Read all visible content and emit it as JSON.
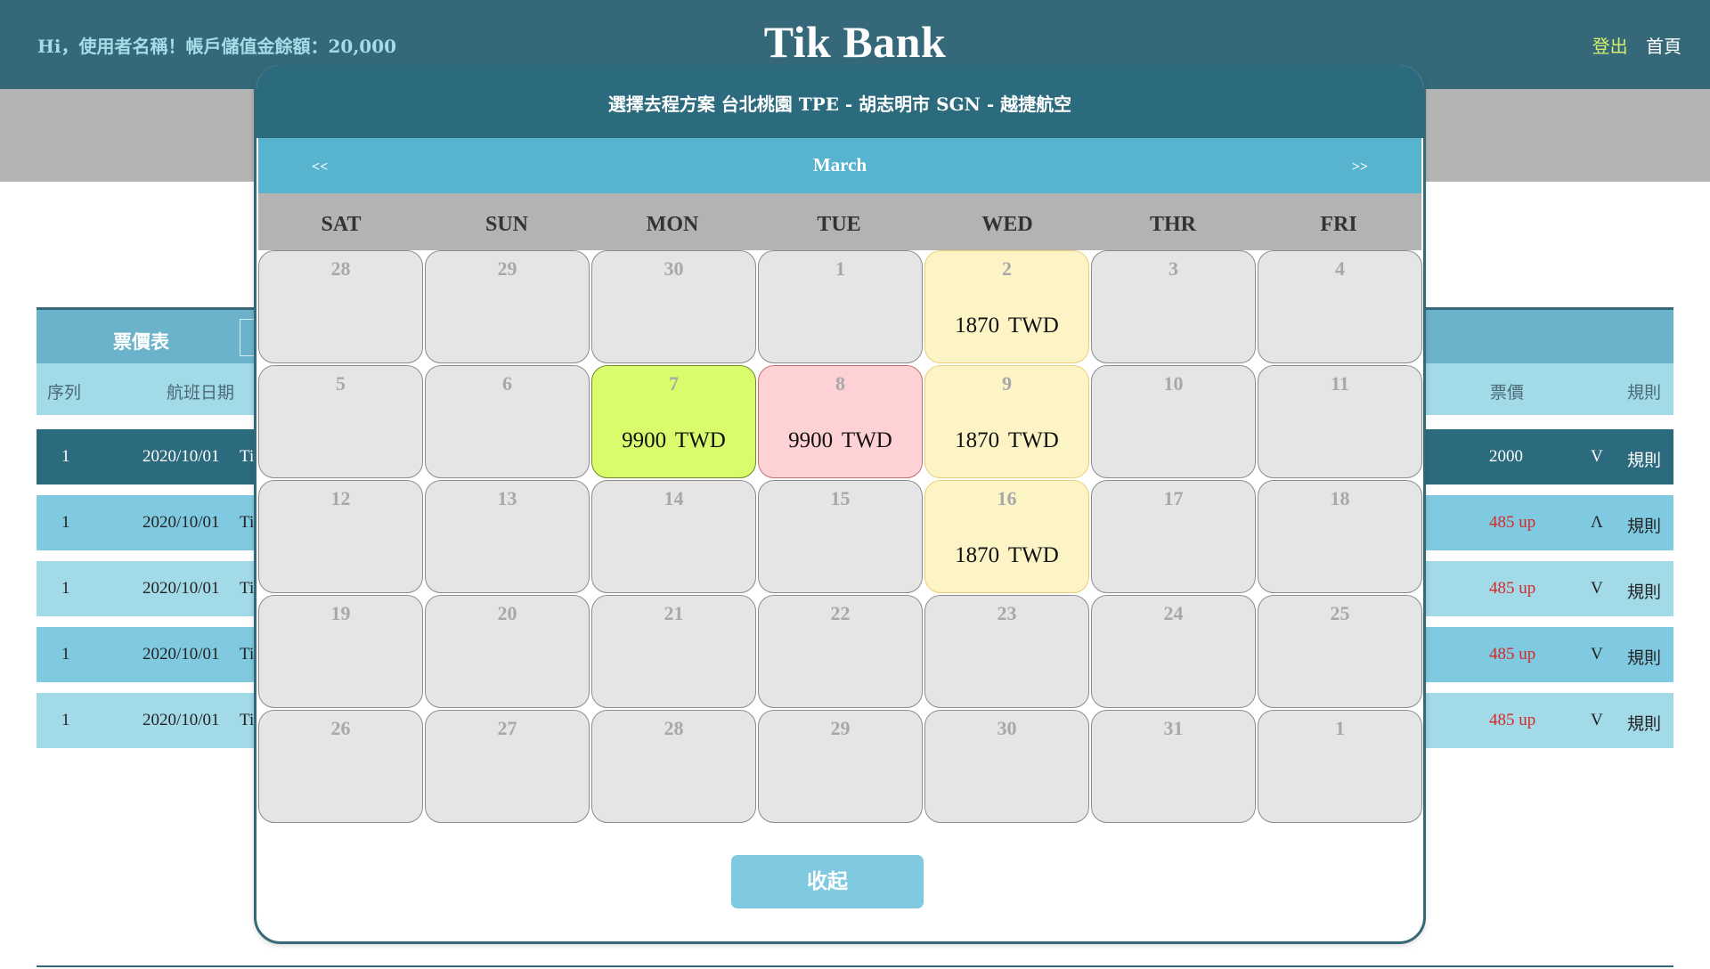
{
  "header": {
    "greeting": "Hi，使用者名稱！帳戶儲值金餘額：20,000",
    "brand": "Tik Bank",
    "logout": "登出",
    "home": "首頁"
  },
  "fare_table": {
    "title": "票價表",
    "columns": {
      "seq": "序列",
      "date": "航班日期",
      "price": "票價",
      "rules": "規則"
    },
    "rows": [
      {
        "seq": "1",
        "date": "2020/10/01",
        "date_suffix": "Ti",
        "price": "2000",
        "toggle": "V",
        "rules": "規則"
      },
      {
        "seq": "1",
        "date": "2020/10/01",
        "date_suffix": "Ti",
        "price": "485 up",
        "toggle": "Λ",
        "rules": "規則"
      },
      {
        "seq": "1",
        "date": "2020/10/01",
        "date_suffix": "Ti",
        "price": "485 up",
        "toggle": "V",
        "rules": "規則"
      },
      {
        "seq": "1",
        "date": "2020/10/01",
        "date_suffix": "Ti",
        "price": "485 up",
        "toggle": "V",
        "rules": "規則"
      },
      {
        "seq": "1",
        "date": "2020/10/01",
        "date_suffix": "Ti",
        "price": "485 up",
        "toggle": "V",
        "rules": "規則"
      }
    ]
  },
  "modal": {
    "title": "選擇去程方案 台北桃園 TPE - 胡志明市 SGN - 越捷航空",
    "month": "March",
    "prev": "<<",
    "next": ">>",
    "weekdays": [
      "SAT",
      "SUN",
      "MON",
      "TUE",
      "WED",
      "THR",
      "FRI"
    ],
    "weeks": [
      [
        {
          "day": "28"
        },
        {
          "day": "29"
        },
        {
          "day": "30"
        },
        {
          "day": "1"
        },
        {
          "day": "2",
          "price": "1870 TWD",
          "state": "yellow"
        },
        {
          "day": "3"
        },
        {
          "day": "4"
        }
      ],
      [
        {
          "day": "5"
        },
        {
          "day": "6"
        },
        {
          "day": "7",
          "price": "9900 TWD",
          "state": "green"
        },
        {
          "day": "8",
          "price": "9900 TWD",
          "state": "pink"
        },
        {
          "day": "9",
          "price": "1870 TWD",
          "state": "yellow"
        },
        {
          "day": "10"
        },
        {
          "day": "11"
        }
      ],
      [
        {
          "day": "12"
        },
        {
          "day": "13"
        },
        {
          "day": "14"
        },
        {
          "day": "15"
        },
        {
          "day": "16",
          "price": "1870 TWD",
          "state": "yellow"
        },
        {
          "day": "17"
        },
        {
          "day": "18"
        }
      ],
      [
        {
          "day": "19"
        },
        {
          "day": "20"
        },
        {
          "day": "21"
        },
        {
          "day": "22"
        },
        {
          "day": "23"
        },
        {
          "day": "24"
        },
        {
          "day": "25"
        }
      ],
      [
        {
          "day": "26"
        },
        {
          "day": "27"
        },
        {
          "day": "28"
        },
        {
          "day": "29"
        },
        {
          "day": "30"
        },
        {
          "day": "31"
        },
        {
          "day": "1"
        }
      ]
    ],
    "collapse_label": "收起"
  },
  "colors": {
    "header_bg": "#35697a",
    "modal_title_bg": "#2c6b7d",
    "month_bar_bg": "#57b3ce",
    "weekday_bg": "#b3b3b3",
    "cell_bg": "#e5e5e5",
    "cell_highlight_yellow": "#fdf4c6",
    "cell_selected_green": "#d8fc6b",
    "cell_selected_pink": "#fed2d4",
    "button_bg": "#7fcae0",
    "price_red": "#d42a2a"
  }
}
